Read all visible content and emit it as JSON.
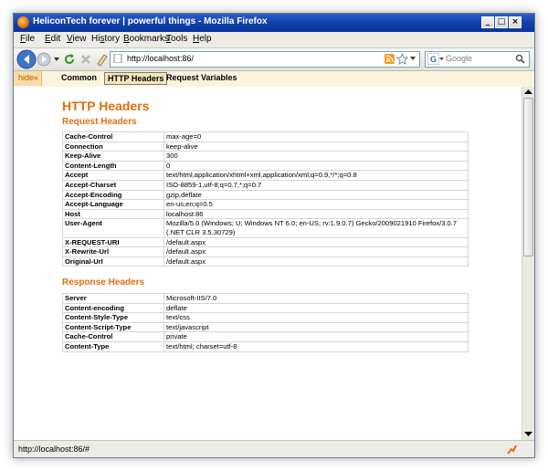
{
  "window": {
    "title": "HeliconTech forever | powerful things - Mozilla Firefox"
  },
  "menu": [
    {
      "label": "File",
      "key": "F",
      "rest": "ile"
    },
    {
      "label": "Edit",
      "key": "E",
      "rest": "dit"
    },
    {
      "label": "View",
      "key": "V",
      "rest": "iew"
    },
    {
      "label": "History",
      "key": "s",
      "pre": "Hi",
      "rest": "tory"
    },
    {
      "label": "Bookmarks",
      "key": "B",
      "rest": "ookmarks"
    },
    {
      "label": "Tools",
      "key": "T",
      "rest": "ools"
    },
    {
      "label": "Help",
      "key": "H",
      "rest": "elp"
    }
  ],
  "navigation": {
    "url": "http://localhost:86/",
    "search_placeholder": "Google"
  },
  "toolbar": {
    "hide_label": "hide",
    "hide_arrow": "«",
    "tabs": [
      "Common",
      "HTTP Headers",
      "Request Variables"
    ],
    "active_tab": "HTTP Headers"
  },
  "page": {
    "title": "HTTP Headers",
    "request_heading": "Request Headers",
    "response_heading": "Response Headers",
    "request_headers": [
      {
        "name": "Cache-Control",
        "value": "max-age=0"
      },
      {
        "name": "Connection",
        "value": "keep-alive"
      },
      {
        "name": "Keep-Alive",
        "value": "300"
      },
      {
        "name": "Content-Length",
        "value": "0"
      },
      {
        "name": "Accept",
        "value": "text/html,application/xhtml+xml,application/xml;q=0.9,*/*;q=0.8"
      },
      {
        "name": "Accept-Charset",
        "value": "ISO-8859-1,utf-8;q=0.7,*;q=0.7"
      },
      {
        "name": "Accept-Encoding",
        "value": "gzip,deflate"
      },
      {
        "name": "Accept-Language",
        "value": "en-us,en;q=0.5"
      },
      {
        "name": "Host",
        "value": "localhost:86"
      },
      {
        "name": "User-Agent",
        "value": "Mozilla/5.0 (Windows; U; Windows NT 6.0; en-US; rv:1.9.0.7) Gecko/2009021910 Firefox/3.0.7 (.NET CLR 3.5.30729)"
      },
      {
        "name": "X-REQUEST-URI",
        "value": "/default.aspx"
      },
      {
        "name": "X-Rewrite-Url",
        "value": "/default.aspx"
      },
      {
        "name": "Original-Url",
        "value": "/default.aspx"
      }
    ],
    "response_headers": [
      {
        "name": "Server",
        "value": "Microsoft-IIS/7.0"
      },
      {
        "name": "Content-encoding",
        "value": "deflate"
      },
      {
        "name": "Content-Style-Type",
        "value": "text/css"
      },
      {
        "name": "Content-Script-Type",
        "value": "text/javascript"
      },
      {
        "name": "Cache-Control",
        "value": "private"
      },
      {
        "name": "Content-Type",
        "value": "text/html; charset=utf-8"
      }
    ]
  },
  "status": {
    "text": "http://localhost:86/#"
  },
  "colors": {
    "heading": "#e06e0c",
    "titlebar": "#0f3fa8",
    "toolbar_bg": "#fbf4dc"
  },
  "icons": [
    "firefox-icon",
    "back-icon",
    "forward-icon",
    "reload-icon",
    "stop-icon",
    "home-icon",
    "rss-icon",
    "star-icon",
    "google-icon",
    "search-icon",
    "minimize-icon",
    "maximize-icon",
    "close-icon"
  ]
}
